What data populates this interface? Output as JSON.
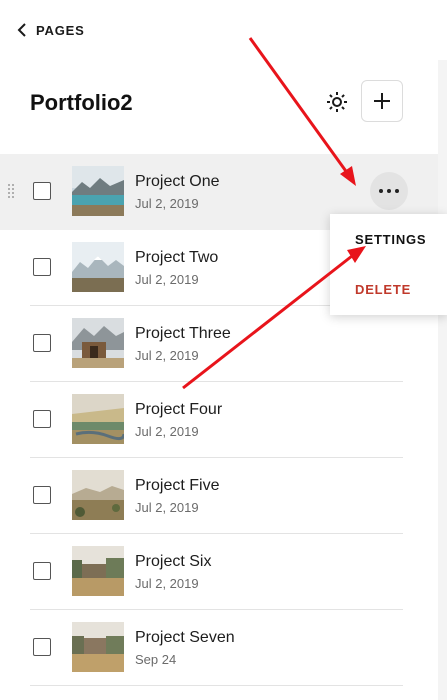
{
  "nav": {
    "back_label": "PAGES"
  },
  "header": {
    "title": "Portfolio2"
  },
  "items": [
    {
      "title": "Project One",
      "date": "Jul 2, 2019",
      "thumb": "lake-mountains"
    },
    {
      "title": "Project Two",
      "date": "Jul 2, 2019",
      "thumb": "snowy-mountains"
    },
    {
      "title": "Project Three",
      "date": "Jul 2, 2019",
      "thumb": "cabin-mountains"
    },
    {
      "title": "Project Four",
      "date": "Jul 2, 2019",
      "thumb": "grassland-water"
    },
    {
      "title": "Project Five",
      "date": "Jul 2, 2019",
      "thumb": "plains-hills"
    },
    {
      "title": "Project Six",
      "date": "Jul 2, 2019",
      "thumb": "dry-field-trees"
    },
    {
      "title": "Project Seven",
      "date": "Sep 24",
      "thumb": "dry-field-trees"
    }
  ],
  "context_menu": {
    "settings_label": "SETTINGS",
    "delete_label": "DELETE"
  },
  "colors": {
    "delete": "#c0392b",
    "annotation_arrow": "#e8141b",
    "highlight_row": "#f0f0f0"
  }
}
